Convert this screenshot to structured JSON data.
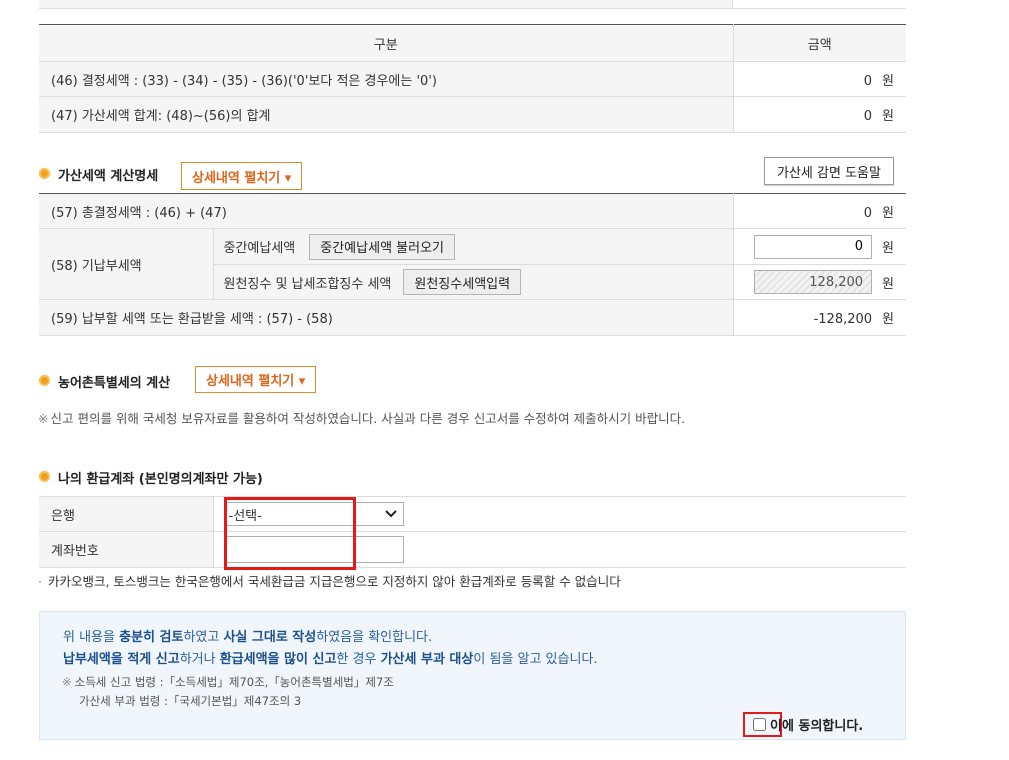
{
  "summary_table": {
    "col_label": "구분",
    "col_amount": "금액",
    "rows": [
      {
        "label": "(46) 결정세액 : (33) - (34) - (35) - (36)('0'보다 적은 경우에는 '0')",
        "amount": "0",
        "unit": "원"
      },
      {
        "label": "(47) 가산세액 합계: (48)~(56)의 합계",
        "amount": "0",
        "unit": "원"
      }
    ]
  },
  "penalty_section": {
    "title": "가산세액 계산명세",
    "expand_label": "상세내역 펼치기 ▾",
    "help_label": "가산세 감면 도움말",
    "row57": {
      "label": "(57) 총결정세액 : (46) + (47)",
      "amount": "0",
      "unit": "원"
    },
    "row58": {
      "label": "(58) 기납부세액",
      "sub1_label": "중간예납세액",
      "sub1_button": "중간예납세액 불러오기",
      "sub1_value": "0",
      "sub2_label": "원천징수 및 납세조합징수 세액",
      "sub2_button": "원천징수세액입력",
      "sub2_value": "128,200",
      "unit": "원"
    },
    "row59": {
      "label": "(59) 납부할 세액 또는 환급받을 세액 : (57) - (58)",
      "amount": "-128,200",
      "unit": "원"
    }
  },
  "rural_section": {
    "title": "농어촌특별세의 계산",
    "expand_label": "상세내역 펼치기 ▾",
    "notice_mark": "※",
    "notice": "신고 편의를 위해 국세청 보유자료를 활용하여 작성하였습니다. 사실과 다른 경우 신고서를 수정하여 제출하시기 바랍니다."
  },
  "refund_section": {
    "title": "나의 환급계좌 (본인명의계좌만 가능)",
    "bank_label": "은행",
    "bank_selected": "-선택-",
    "account_label": "계좌번호",
    "account_value": "",
    "note_mark": "·",
    "note": "카카오뱅크, 토스뱅크는 한국은행에서 국세환급금 지급은행으로 지정하지 않아 환급계좌로 등록할 수 없습니다"
  },
  "agreement": {
    "line1_pre": "위 내용을 ",
    "line1_b1": "충분히 검토",
    "line1_mid": "하였고 ",
    "line1_b2": "사실 그대로 작성",
    "line1_post": "하였음을 확인합니다.",
    "line2_b1": "납부세액을 적게 신고",
    "line2_mid1": "하거나 ",
    "line2_b2": "환급세액을 많이 신고",
    "line2_mid2": "한 경우 ",
    "line2_b3": "가산세 부과 대상",
    "line2_post": "이 됨을 알고 있습니다.",
    "law_mark": "※",
    "law1": "소득세 신고 법령 :「소득세법」제70조,「농어촌특별세법」제7조",
    "law2": "가산세 부과 법령 :「국세기본법」제47조의 3",
    "checkbox_label_prefix": "이",
    "checkbox_label_suffix": "에 동의합니다."
  },
  "colors": {
    "accent_orange": "#e0651a",
    "highlight_red": "#e21a1a",
    "agree_bg": "#f0f6fc"
  }
}
